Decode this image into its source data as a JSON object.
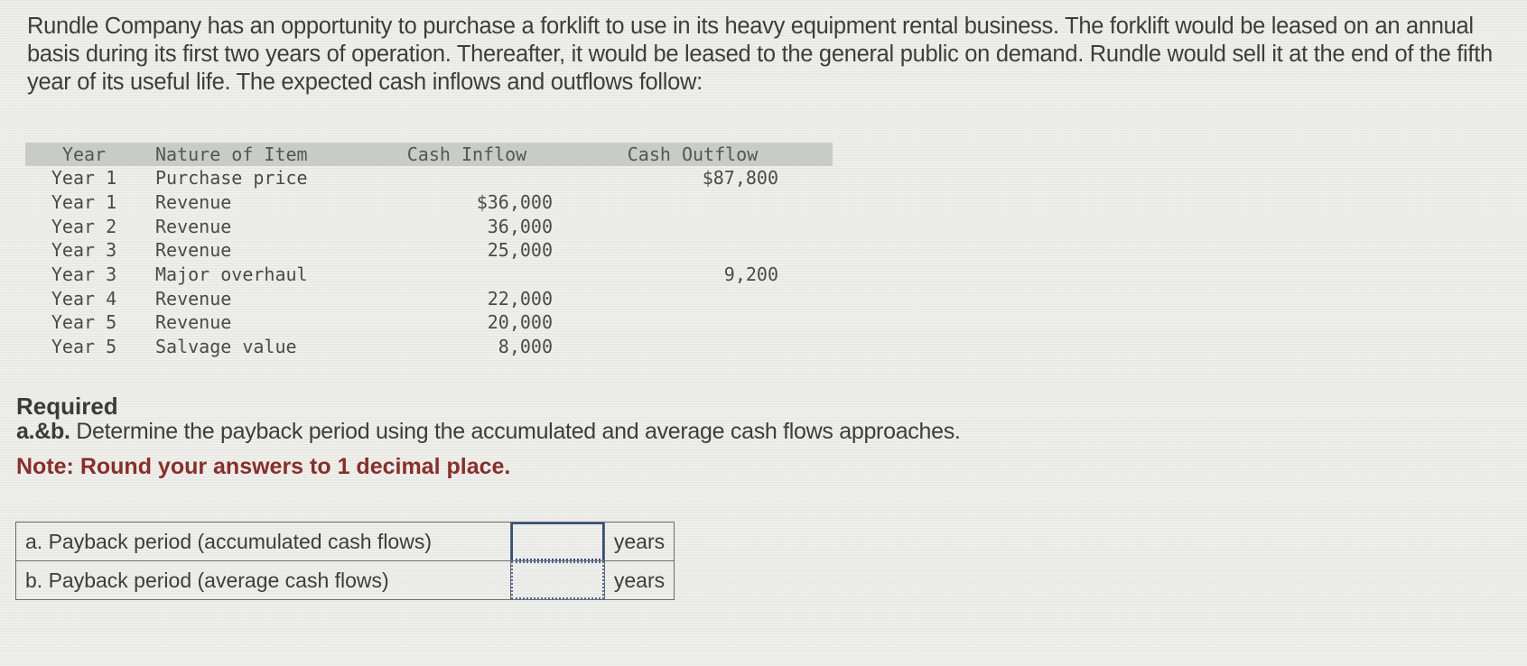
{
  "intro": "Rundle Company has an opportunity to purchase a forklift to use in its heavy equipment rental business. The forklift would be leased on an annual basis during its first two years of operation. Thereafter, it would be leased to the general public on demand. Rundle would sell it at the end of the fifth year of its useful life. The expected cash inflows and outflows follow:",
  "table": {
    "headers": [
      "Year",
      "Nature of Item",
      "Cash Inflow",
      "Cash Outflow"
    ],
    "rows": [
      {
        "year": "Year 1",
        "item": "Purchase price",
        "inflow": "",
        "outflow": "$87,800"
      },
      {
        "year": "Year 1",
        "item": "Revenue",
        "inflow": "$36,000",
        "outflow": ""
      },
      {
        "year": "Year 2",
        "item": "Revenue",
        "inflow": "36,000",
        "outflow": ""
      },
      {
        "year": "Year 3",
        "item": "Revenue",
        "inflow": "25,000",
        "outflow": ""
      },
      {
        "year": "Year 3",
        "item": "Major overhaul",
        "inflow": "",
        "outflow": "9,200"
      },
      {
        "year": "Year 4",
        "item": "Revenue",
        "inflow": "22,000",
        "outflow": ""
      },
      {
        "year": "Year 5",
        "item": "Revenue",
        "inflow": "20,000",
        "outflow": ""
      },
      {
        "year": "Year 5",
        "item": "Salvage value",
        "inflow": "8,000",
        "outflow": ""
      }
    ]
  },
  "required": {
    "heading": "Required",
    "task_prefix": "a.&b.",
    "task_text": " Determine the payback period using the accumulated and average cash flows approaches.",
    "note": "Note: Round your answers to 1 decimal place."
  },
  "answers": [
    {
      "label": "a. Payback period (accumulated cash flows)",
      "value": "",
      "unit": "years"
    },
    {
      "label": "b. Payback period (average cash flows)",
      "value": "",
      "unit": "years"
    }
  ],
  "colors": {
    "note": "#8a2d2a",
    "input_border": "#2d4f86",
    "table_header_bg": "#c9cbc8"
  }
}
